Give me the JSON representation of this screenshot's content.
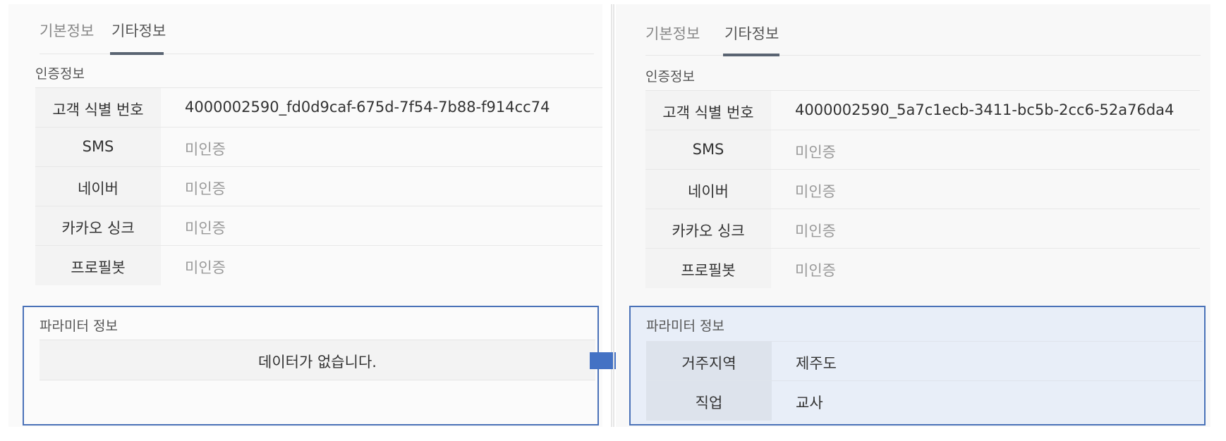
{
  "colors": {
    "highlight_border": "#4a72b8",
    "arrow_fill": "#4472c4",
    "param_box_fill": "#e8eef8",
    "tab_underline": "#5a6472"
  },
  "left": {
    "tabs": [
      {
        "label": "기본정보"
      },
      {
        "label": "기타정보"
      }
    ],
    "auth_section_title": "인증정보",
    "auth_rows": [
      {
        "label": "고객 식별 번호",
        "value": "4000002590_fd0d9caf-675d-7f54-7b88-f914cc74"
      },
      {
        "label": "SMS",
        "value": "미인증"
      },
      {
        "label": "네이버",
        "value": "미인증"
      },
      {
        "label": "카카오 싱크",
        "value": "미인증"
      },
      {
        "label": "프로필봇",
        "value": "미인증"
      }
    ],
    "param_section_title": "파라미터 정보",
    "param_empty_message": "데이터가 없습니다."
  },
  "right": {
    "tabs": [
      {
        "label": "기본정보"
      },
      {
        "label": "기타정보"
      }
    ],
    "auth_section_title": "인증정보",
    "auth_rows": [
      {
        "label": "고객 식별 번호",
        "value": "4000002590_5a7c1ecb-3411-bc5b-2cc6-52a76da4"
      },
      {
        "label": "SMS",
        "value": "미인증"
      },
      {
        "label": "네이버",
        "value": "미인증"
      },
      {
        "label": "카카오 싱크",
        "value": "미인증"
      },
      {
        "label": "프로필봇",
        "value": "미인증"
      }
    ],
    "param_section_title": "파라미터 정보",
    "param_rows": [
      {
        "label": "거주지역",
        "value": "제주도"
      },
      {
        "label": "직업",
        "value": "교사"
      }
    ]
  }
}
